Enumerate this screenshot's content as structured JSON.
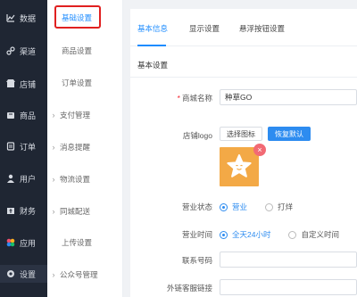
{
  "sidebar": {
    "items": [
      {
        "label": "数据",
        "icon": "chart-line-icon"
      },
      {
        "label": "渠道",
        "icon": "link-icon"
      },
      {
        "label": "店铺",
        "icon": "store-icon"
      },
      {
        "label": "商品",
        "icon": "goods-icon"
      },
      {
        "label": "订单",
        "icon": "order-icon"
      },
      {
        "label": "用户",
        "icon": "user-icon"
      },
      {
        "label": "财务",
        "icon": "finance-icon"
      },
      {
        "label": "应用",
        "icon": "apps-icon"
      },
      {
        "label": "设置",
        "icon": "settings-icon"
      }
    ]
  },
  "submenu": {
    "items": [
      {
        "label": "基础设置",
        "arrow": false
      },
      {
        "label": "商品设置",
        "arrow": false
      },
      {
        "label": "订单设置",
        "arrow": false
      },
      {
        "label": "支付管理",
        "arrow": true
      },
      {
        "label": "消息提醒",
        "arrow": true
      },
      {
        "label": "物流设置",
        "arrow": true
      },
      {
        "label": "同城配送",
        "arrow": true
      },
      {
        "label": "上传设置",
        "arrow": false
      },
      {
        "label": "公众号管理",
        "arrow": true
      }
    ]
  },
  "tabs": [
    {
      "label": "基本信息"
    },
    {
      "label": "显示设置"
    },
    {
      "label": "悬浮按钮设置"
    }
  ],
  "section_title": "基本设置",
  "form": {
    "shop_name_label": "商城名称",
    "shop_name_value": "种草GO",
    "logo_label": "店铺logo",
    "choose_icon_button": "选择图标",
    "restore_default_button": "恢复默认",
    "logo_remove": "×",
    "status_label": "营业状态",
    "status_options": [
      "营业",
      "打烊"
    ],
    "hours_label": "营业时间",
    "hours_options": [
      "全天24小时",
      "自定义时间"
    ],
    "phone_label": "联系号码",
    "phone_value": "",
    "service_link_label": "外链客服链接",
    "service_link_value": ""
  },
  "colors": {
    "sidebar_bg": "#1f2633",
    "accent": "#1e8cff",
    "logo_bg": "#f3a946",
    "highlight_box": "#e02020"
  }
}
